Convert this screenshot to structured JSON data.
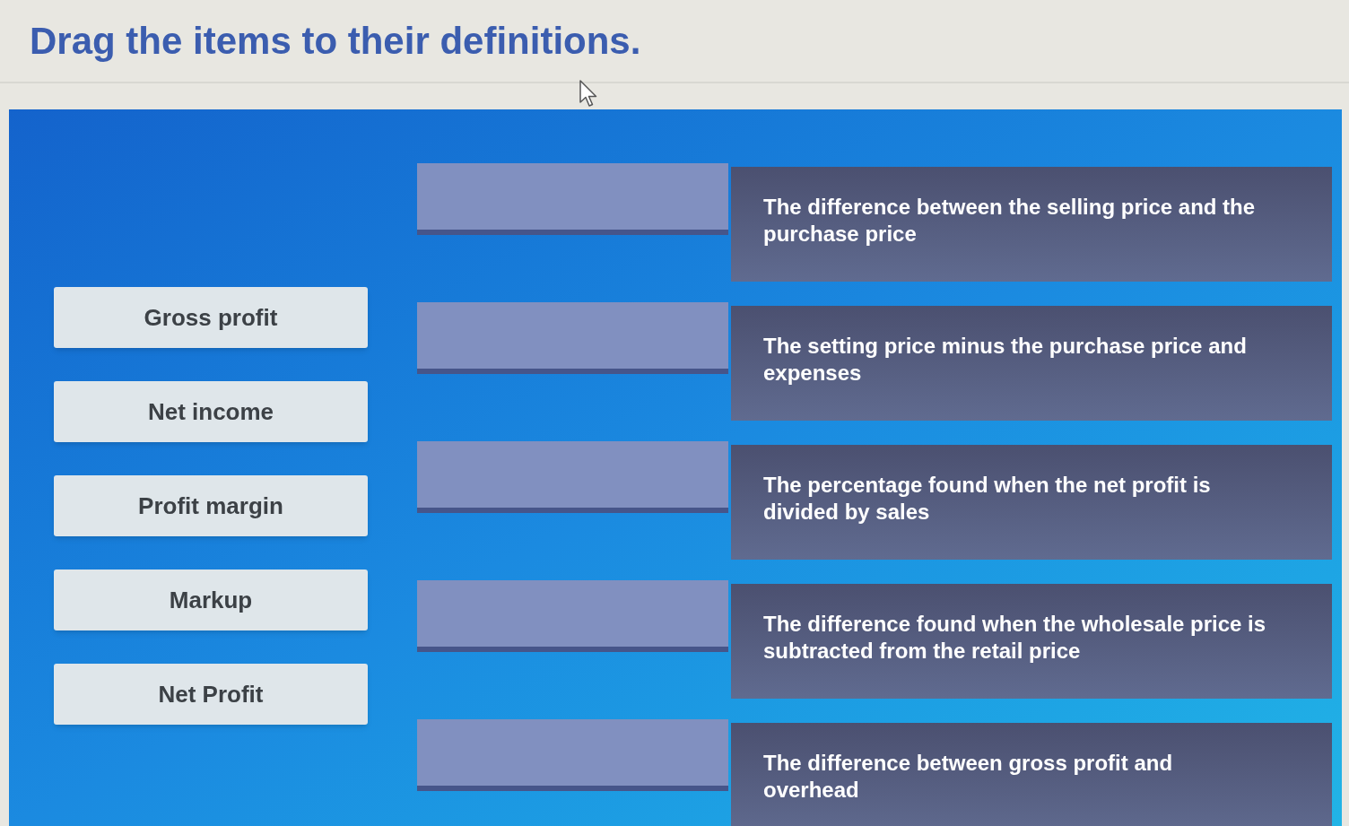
{
  "instruction": "Drag the items to their definitions.",
  "items": [
    {
      "label": "Gross profit"
    },
    {
      "label": "Net income"
    },
    {
      "label": "Profit margin"
    },
    {
      "label": "Markup"
    },
    {
      "label": "Net Profit"
    }
  ],
  "targets": [
    {
      "definition": "The difference between the selling price and the purchase price"
    },
    {
      "definition": "The setting price minus the purchase price and expenses"
    },
    {
      "definition": "The percentage found when the net profit is divided by sales"
    },
    {
      "definition": "The difference found when the wholesale price is subtracted from the retail price"
    },
    {
      "definition": "The difference between gross profit and overhead"
    }
  ]
}
